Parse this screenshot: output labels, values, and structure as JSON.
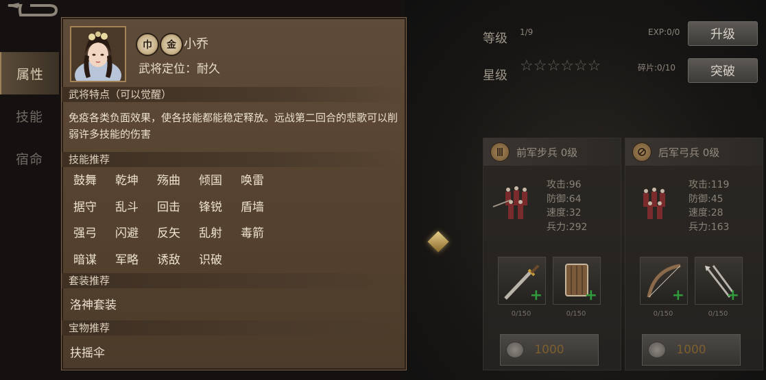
{
  "nav": {
    "items": [
      {
        "label": "属性"
      },
      {
        "label": "技能"
      },
      {
        "label": "宿命"
      }
    ]
  },
  "hero": {
    "badge_1": "巾",
    "badge_2": "金",
    "name": "小乔",
    "role": "武将定位：耐久"
  },
  "feature": {
    "heading": "武将特点（可以觉醒）",
    "description": "免疫各类负面效果，使各技能都能稳定释放。远战第二回合的悲歌可以削弱许多技能的伤害"
  },
  "skills": {
    "heading": "技能推荐",
    "items": [
      "鼓舞",
      "乾坤",
      "殇曲",
      "倾国",
      "唤雷",
      "据守",
      "乱斗",
      "回击",
      "锋锐",
      "盾墙",
      "强弓",
      "闪避",
      "反矢",
      "乱射",
      "毒箭",
      "暗谋",
      "军略",
      "诱敌",
      "识破"
    ]
  },
  "suit": {
    "heading": "套装推荐",
    "value": "洛神套装"
  },
  "treasure": {
    "heading": "宝物推荐",
    "value": "扶摇伞"
  },
  "level": {
    "label": "等级",
    "value": "1/9",
    "exp": "EXP:0/0",
    "button": "升级"
  },
  "star": {
    "label": "星级",
    "stars_filled": 0,
    "stars_total": 6,
    "shards": "碎片:0/10",
    "button": "突破"
  },
  "units": [
    {
      "icon": "spear-icon",
      "title": "前军步兵 0级",
      "stats": [
        "攻击:96",
        "防御:64",
        "速度:32",
        "兵力:292"
      ],
      "equip": [
        {
          "count": "0/150"
        },
        {
          "count": "0/150"
        }
      ],
      "cost": "1000"
    },
    {
      "icon": "shield-icon",
      "title": "后军弓兵 0级",
      "stats": [
        "攻击:119",
        "防御:45",
        "速度:28",
        "兵力:163"
      ],
      "equip": [
        {
          "count": "0/150"
        },
        {
          "count": "0/150"
        }
      ],
      "cost": "1000"
    }
  ],
  "colors": {
    "panel": "#56432f",
    "plus_green": "#2f9b3a",
    "cost_gold": "#7d5f2e"
  }
}
